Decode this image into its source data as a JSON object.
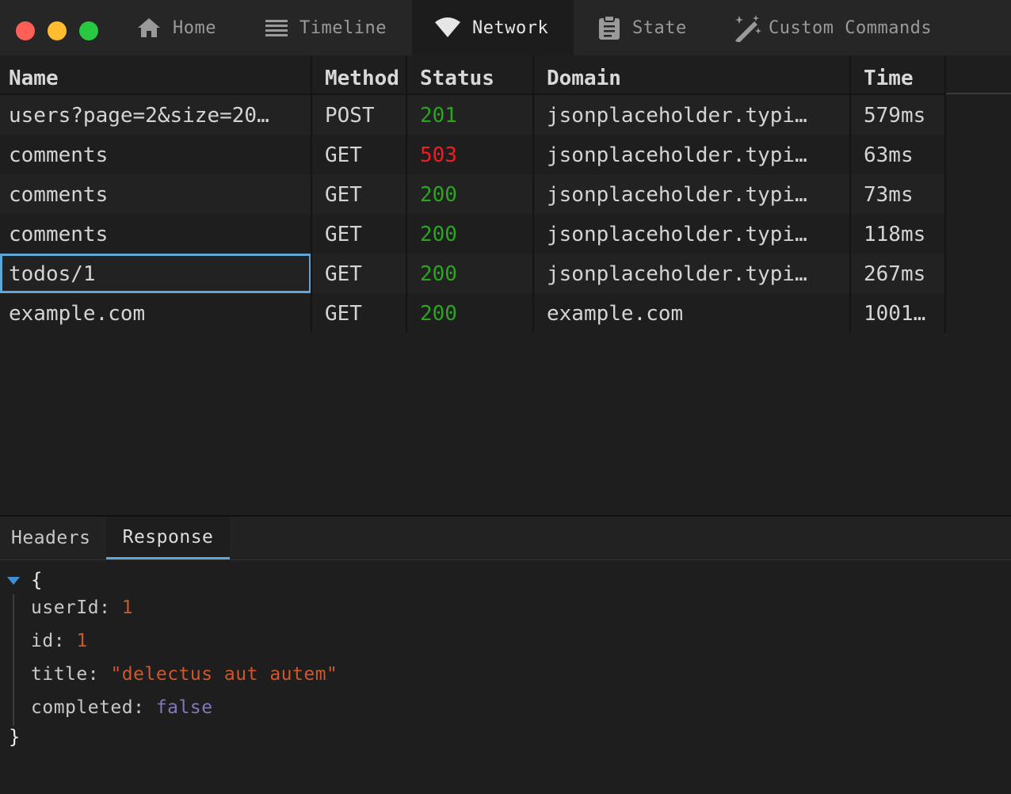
{
  "window": {
    "traffic_lights": [
      "close",
      "minimize",
      "maximize"
    ]
  },
  "tabs": [
    {
      "label": "Home",
      "icon": "home-icon"
    },
    {
      "label": "Timeline",
      "icon": "list-icon"
    },
    {
      "label": "Network",
      "icon": "wifi-icon",
      "active": true
    },
    {
      "label": "State",
      "icon": "clipboard-icon"
    },
    {
      "label": "Custom Commands",
      "icon": "magic-wand-icon"
    }
  ],
  "table": {
    "headers": {
      "name": "Name",
      "method": "Method",
      "status": "Status",
      "domain": "Domain",
      "time": "Time"
    },
    "rows": [
      {
        "name": "users?page=2&size=20…",
        "method": "POST",
        "status": "201",
        "domain": "jsonplaceholder.typi…",
        "time": "579ms"
      },
      {
        "name": "comments",
        "method": "GET",
        "status": "503",
        "domain": "jsonplaceholder.typi…",
        "time": "63ms"
      },
      {
        "name": "comments",
        "method": "GET",
        "status": "200",
        "domain": "jsonplaceholder.typi…",
        "time": "73ms"
      },
      {
        "name": "comments",
        "method": "GET",
        "status": "200",
        "domain": "jsonplaceholder.typi…",
        "time": "118ms"
      },
      {
        "name": "todos/1",
        "method": "GET",
        "status": "200",
        "domain": "jsonplaceholder.typi…",
        "time": "267ms",
        "selected": true
      },
      {
        "name": "example.com",
        "method": "GET",
        "status": "200",
        "domain": "example.com",
        "time": "1001…"
      }
    ]
  },
  "detail": {
    "tabs": [
      {
        "label": "Headers"
      },
      {
        "label": "Response",
        "active": true
      }
    ],
    "response": {
      "open_brace": "{",
      "close_brace": "}",
      "fields": [
        {
          "key": "userId",
          "value": "1",
          "type": "number"
        },
        {
          "key": "id",
          "value": "1",
          "type": "number"
        },
        {
          "key": "title",
          "value": "\"delectus aut autem\"",
          "type": "string"
        },
        {
          "key": "completed",
          "value": "false",
          "type": "boolean"
        }
      ]
    }
  },
  "colors": {
    "status_ok": "#2ba51e",
    "status_error": "#ee1c24",
    "accent": "#5fa6d8",
    "json_number": "#c35a2c",
    "json_string": "#d0562c",
    "json_boolean": "#7f7ab8"
  }
}
